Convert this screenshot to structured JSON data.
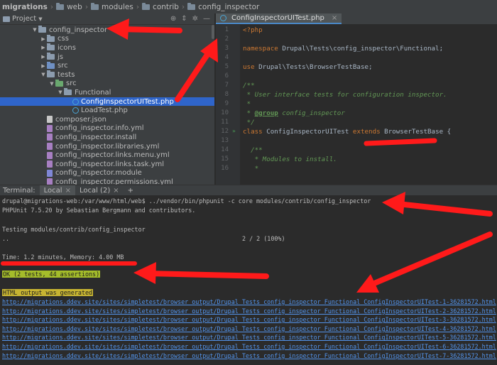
{
  "breadcrumbs": [
    "migrations",
    "web",
    "modules",
    "contrib",
    "config_inspector"
  ],
  "project_panel": {
    "title": "Project",
    "tree": [
      {
        "label": "config_inspector",
        "type": "folder",
        "depth": 4,
        "expanded": true
      },
      {
        "label": "css",
        "type": "folder",
        "depth": 5,
        "expanded": false
      },
      {
        "label": "icons",
        "type": "folder",
        "depth": 5,
        "expanded": false
      },
      {
        "label": "js",
        "type": "folder",
        "depth": 5,
        "expanded": false
      },
      {
        "label": "src",
        "type": "src",
        "depth": 5,
        "expanded": false
      },
      {
        "label": "tests",
        "type": "folder",
        "depth": 5,
        "expanded": true
      },
      {
        "label": "src",
        "type": "tst",
        "depth": 6,
        "expanded": true
      },
      {
        "label": "Functional",
        "type": "folder",
        "depth": 7,
        "expanded": true
      },
      {
        "label": "ConfigInspectorUITest.php",
        "type": "php",
        "depth": 8,
        "selected": true
      },
      {
        "label": "LoadTest.php",
        "type": "php",
        "depth": 8
      },
      {
        "label": "composer.json",
        "type": "json",
        "depth": 5
      },
      {
        "label": "config_inspector.info.yml",
        "type": "yml",
        "depth": 5
      },
      {
        "label": "config_inspector.install",
        "type": "yml",
        "depth": 5
      },
      {
        "label": "config_inspector.libraries.yml",
        "type": "yml",
        "depth": 5
      },
      {
        "label": "config_inspector.links.menu.yml",
        "type": "yml",
        "depth": 5
      },
      {
        "label": "config_inspector.links.task.yml",
        "type": "yml",
        "depth": 5
      },
      {
        "label": "config_inspector.module",
        "type": "mod",
        "depth": 5
      },
      {
        "label": "config_inspector.permissions.yml",
        "type": "yml",
        "depth": 5
      }
    ]
  },
  "editor": {
    "tab_label": "ConfigInspectorUITest.php",
    "line_numbers": [
      "1",
      "2",
      "3",
      "4",
      "5",
      "6",
      "7",
      "8",
      "9",
      "10",
      "11",
      "12",
      "13",
      "14",
      "15",
      "16"
    ],
    "lines": [
      [
        {
          "t": "<?php",
          "c": "kw"
        }
      ],
      [],
      [
        {
          "t": "namespace ",
          "c": "kw"
        },
        {
          "t": "Drupal\\Tests\\config_inspector\\Functional;",
          "c": ""
        }
      ],
      [],
      [
        {
          "t": "use ",
          "c": "kw"
        },
        {
          "t": "Drupal\\Tests\\BrowserTestBase;",
          "c": ""
        }
      ],
      [],
      [
        {
          "t": "/**",
          "c": "cm"
        }
      ],
      [
        {
          "t": " * User interface tests for configuration inspector.",
          "c": "cm"
        }
      ],
      [
        {
          "t": " *",
          "c": "cm"
        }
      ],
      [
        {
          "t": " * ",
          "c": "cm"
        },
        {
          "t": "@group",
          "c": "tg"
        },
        {
          "t": " config_inspector",
          "c": "cm"
        }
      ],
      [
        {
          "t": " */",
          "c": "cm"
        }
      ],
      [
        {
          "t": "class ",
          "c": "kw"
        },
        {
          "t": "ConfigInspectorUITest ",
          "c": ""
        },
        {
          "t": "extends ",
          "c": "kw"
        },
        {
          "t": "BrowserTestBase {",
          "c": ""
        }
      ],
      [],
      [
        {
          "t": "  /**",
          "c": "cm"
        }
      ],
      [
        {
          "t": "   * Modules to install.",
          "c": "cm"
        }
      ],
      [
        {
          "t": "   *",
          "c": "cm"
        }
      ]
    ]
  },
  "terminal": {
    "label": "Terminal:",
    "tabs": [
      "Local",
      "Local (2)"
    ],
    "add_tab": "+",
    "command": "drupal@migrations-web:/var/www/html/web$ ../vendor/bin/phpunit -c core modules/contrib/config_inspector",
    "version": "PHPUnit 7.5.20 by Sebastian Bergmann and contributors.",
    "testing": "Testing modules/contrib/config_inspector",
    "dots": "..",
    "progress": "2 / 2 (100%)",
    "time": "Time: 1.2 minutes, Memory: 4.00 MB",
    "ok": "OK (2 tests, 44 assertions)",
    "html_output": "HTML output was generated",
    "links": [
      "http://migrations.ddev.site/sites/simpletest/browser_output/Drupal_Tests_config_inspector_Functional_ConfigInspectorUITest-1-36281572.html",
      "http://migrations.ddev.site/sites/simpletest/browser_output/Drupal_Tests_config_inspector_Functional_ConfigInspectorUITest-2-36281572.html",
      "http://migrations.ddev.site/sites/simpletest/browser_output/Drupal_Tests_config_inspector_Functional_ConfigInspectorUITest-3-36281572.html",
      "http://migrations.ddev.site/sites/simpletest/browser_output/Drupal_Tests_config_inspector_Functional_ConfigInspectorUITest-4-36281572.html",
      "http://migrations.ddev.site/sites/simpletest/browser_output/Drupal_Tests_config_inspector_Functional_ConfigInspectorUITest-5-36281572.html",
      "http://migrations.ddev.site/sites/simpletest/browser_output/Drupal_Tests_config_inspector_Functional_ConfigInspectorUITest-6-36281572.html",
      "http://migrations.ddev.site/sites/simpletest/browser_output/Drupal_Tests_config_inspector_Functional_ConfigInspectorUITest-7-36281572.html"
    ]
  },
  "colors": {
    "annotation": "#ff1a1a",
    "selection": "#2f65ca",
    "link": "#5394ec",
    "ok_highlight": "#a4bc2a"
  }
}
